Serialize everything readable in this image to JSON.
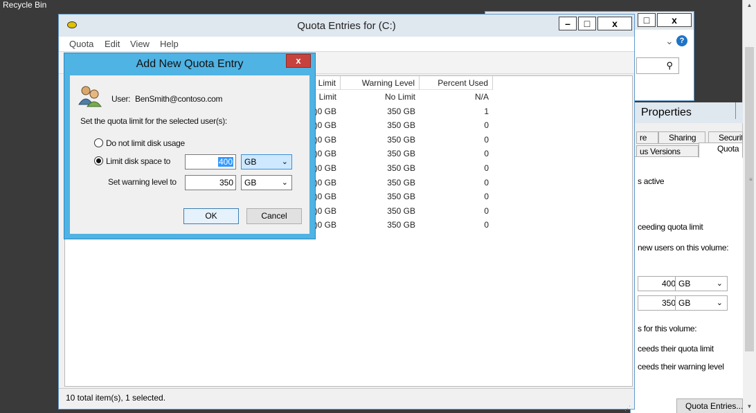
{
  "desktop": {
    "recycle_bin_label": "Recycle Bin"
  },
  "background_window": {
    "minimize_glyph": "–",
    "maximize_glyph": "□",
    "close_glyph": "x",
    "chevron": "⌄",
    "help_glyph": "?",
    "search_glyph": "⚲"
  },
  "properties_dialog": {
    "title": "Properties",
    "tabs_row1": [
      "re",
      "Sharing",
      "Securit"
    ],
    "tabs_row2": [
      "us Versions",
      "Quota"
    ],
    "lines": {
      "status": "s active",
      "exceeding": "ceeding quota limit",
      "new_users": "new users on this volume:",
      "for_volume": "s for this volume:",
      "exceeds_quota": "ceeds their quota limit",
      "exceeds_warning": "ceeds their warning level"
    },
    "limit_value": "400",
    "limit_unit": "GB",
    "warning_value": "350",
    "warning_unit": "GB",
    "quota_entries_button": "Quota Entries..."
  },
  "main_window": {
    "title": "Quota Entries for  (C:)",
    "minimize_glyph": "–",
    "maximize_glyph": "□",
    "close_glyph": "x",
    "menu": [
      "Quota",
      "Edit",
      "View",
      "Help"
    ],
    "columns": [
      "Limit",
      "Warning Level",
      "Percent Used"
    ],
    "rows": [
      {
        "limit": "Limit",
        "warning": "No Limit",
        "percent": "N/A"
      },
      {
        "limit": ")0 GB",
        "warning": "350 GB",
        "percent": "1"
      },
      {
        "limit": ")0 GB",
        "warning": "350 GB",
        "percent": "0"
      },
      {
        "limit": ")0 GB",
        "warning": "350 GB",
        "percent": "0"
      },
      {
        "limit": ")0 GB",
        "warning": "350 GB",
        "percent": "0"
      },
      {
        "limit": ")0 GB",
        "warning": "350 GB",
        "percent": "0"
      },
      {
        "limit": ")0 GB",
        "warning": "350 GB",
        "percent": "0"
      },
      {
        "limit": ")0 GB",
        "warning": "350 GB",
        "percent": "0"
      },
      {
        "limit": ")0 GB",
        "warning": "350 GB",
        "percent": "0"
      },
      {
        "limit": ")0 GB",
        "warning": "350 GB",
        "percent": "0"
      }
    ],
    "status": "10 total item(s), 1 selected."
  },
  "add_quota_dialog": {
    "title": "Add New Quota Entry",
    "close_glyph": "x",
    "user_label": "User:",
    "user_value": "BenSmith@contoso.com",
    "instruction": "Set the quota limit for the selected user(s):",
    "option_no_limit": "Do not limit disk usage",
    "option_limit": "Limit disk space to",
    "warning_label": "Set warning level to",
    "limit_value": "400",
    "limit_unit": "GB",
    "warning_value": "350",
    "warning_unit": "GB",
    "ok_label": "OK",
    "cancel_label": "Cancel"
  },
  "colors": {
    "dialog_frame": "#4fb3e3",
    "close_red": "#c7423d",
    "selection_blue": "#3399ff",
    "title_bar": "#dfe7ef"
  }
}
